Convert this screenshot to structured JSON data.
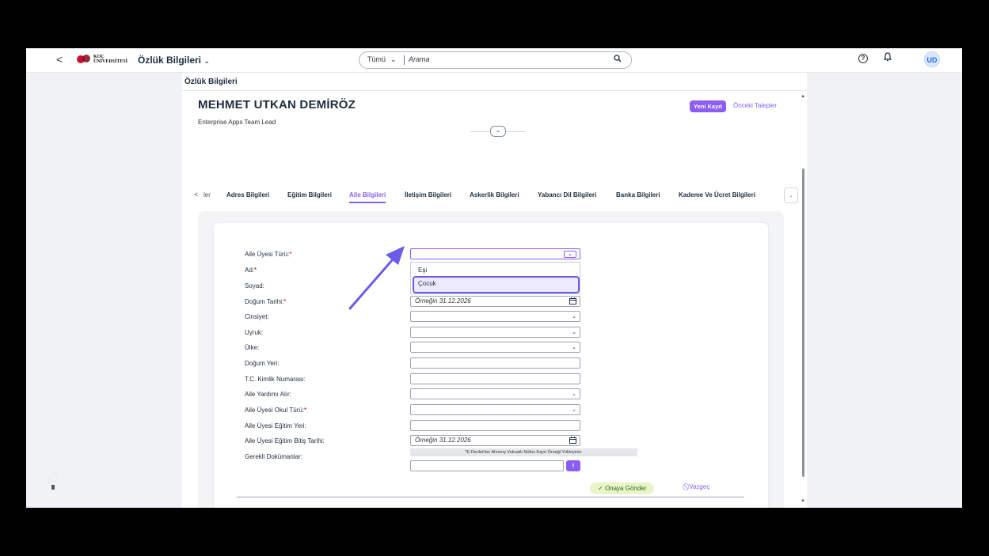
{
  "shell": {
    "back": "<",
    "logo_text_1": "KOÇ",
    "logo_text_2": "ÜNİVERSİTESİ",
    "app_title": "Özlük Bilgileri",
    "search_scope": "Tümü",
    "search_placeholder": "Arama",
    "avatar": "UD"
  },
  "page": {
    "title": "Özlük Bilgileri",
    "employee_name": "MEHMET UTKAN DEMİRÖZ",
    "employee_role": "Enterprise Apps Team Lead",
    "new_record": "Yeni Kayıt",
    "previous_requests": "Önceki Talepler"
  },
  "tabs": {
    "first_partial": "ler",
    "items": [
      "Adres Bilgileri",
      "Eğitim Bilgileri",
      "Aile Bilgileri",
      "İletişim Bilgileri",
      "Askerlik Bilgileri",
      "Yabancı Dil Bilgileri",
      "Banka Bilgileri",
      "Kademe Ve Ücret Bilgileri"
    ],
    "active": "Aile Bilgileri"
  },
  "form": {
    "labels": {
      "family_member_type": "Aile Üyesi Türü:",
      "first_name": "Ad:",
      "last_name": "Soyad:",
      "birth_date": "Doğum Tarihi:",
      "gender": "Cinsiyet:",
      "nationality": "Uyruk:",
      "country": "Ülke:",
      "birth_place": "Doğum Yeri:",
      "tc_id": "T.C. Kimlik Numarası:",
      "family_aid": "Aile Yardımı Alır:",
      "school_type": "Aile Üyesi Okul Türü:",
      "education_place": "Aile Üyesi Eğitim Yeri:",
      "education_end_date": "Aile Üyesi Eğitim Bitiş Tarihi:",
      "required_docs": "Gerekli Dokümanlar:"
    },
    "required_mark": "*",
    "date_placeholder": "Örneğin 31.12.2026",
    "dropdown_options": [
      "Eşi",
      "Çocuk"
    ],
    "highlighted_option": "Çocuk",
    "doc_note": "*E-Devlet'ten Alınmış Vukuatlı Nüfus Kayıt Örneği Yükleyiniz.",
    "submit": "Onaya Gönder",
    "cancel": "Vazgeç"
  },
  "colors": {
    "accent": "#8b5cf6",
    "annotation_arrow": "#6c5ce7",
    "required": "#bb0000",
    "submit_bg": "#e9f5c9"
  }
}
